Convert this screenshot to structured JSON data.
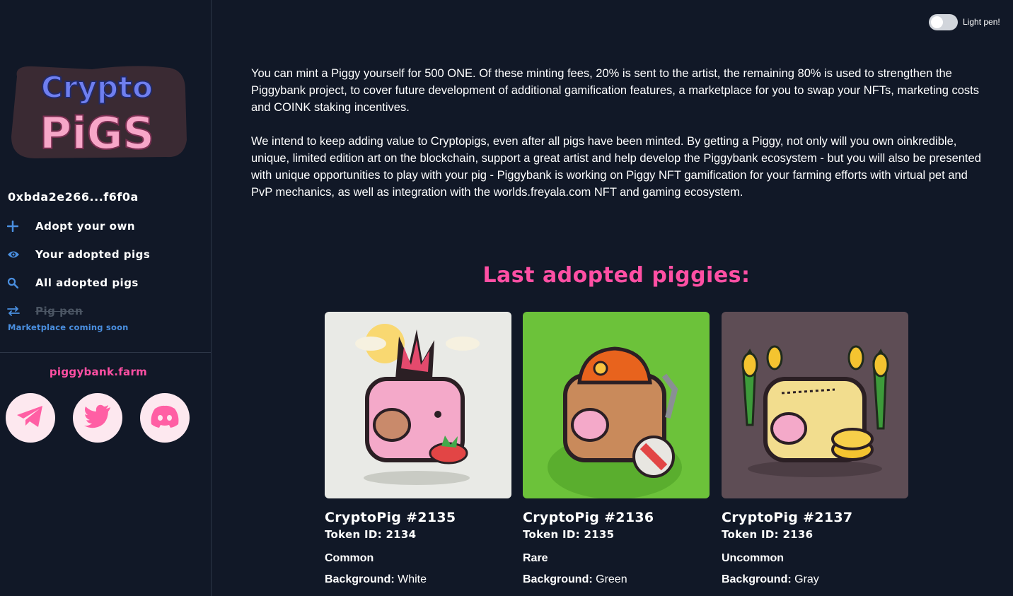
{
  "toggle": {
    "label": "Light pen!"
  },
  "logo": {
    "line1": "Crypto",
    "line2": "PiGS"
  },
  "sidebar": {
    "wallet": "0xbda2e266...f6f0a",
    "nav": [
      {
        "label": "Adopt your own",
        "icon": "plus-icon"
      },
      {
        "label": "Your adopted pigs",
        "icon": "eye-icon"
      },
      {
        "label": "All adopted pigs",
        "icon": "search-icon"
      },
      {
        "label": "Pig pen",
        "icon": "swap-arrows-icon",
        "disabled": true
      }
    ],
    "note": "Marketplace coming soon",
    "farm_link": "piggybank.farm",
    "socials": [
      "telegram-icon",
      "twitter-icon",
      "discord-icon"
    ]
  },
  "main": {
    "para1": "You can mint a Piggy yourself for 500 ONE. Of these minting fees, 20% is sent to the artist, the remaining 80% is used to strengthen the Piggybank project, to cover future development of additional gamification features, a marketplace for you to swap your NFTs, marketing costs and COINK staking incentives.",
    "para2": "We intend to keep adding value to Cryptopigs, even after all pigs have been minted. By getting a Piggy, not only will you own oinkredible, unique, limited edition art on the blockchain, support a great artist and help develop the Piggybank ecosystem - but you will also be presented with unique opportunities to play with your pig - Piggybank is working on Piggy NFT gamification for your farming efforts with virtual pet and PvP mechanics, as well as integration with the worlds.freyala.com NFT and gaming ecosystem.",
    "section_title": "Last adopted piggies:",
    "background_label": "Background:",
    "cards": [
      {
        "name": "CryptoPig #2135",
        "token": "Token ID: 2134",
        "rarity": "Common",
        "background": "White",
        "bg_color": "#e9eae6"
      },
      {
        "name": "CryptoPig #2136",
        "token": "Token ID: 2135",
        "rarity": "Rare",
        "background": "Green",
        "bg_color": "#6cc23a"
      },
      {
        "name": "CryptoPig #2137",
        "token": "Token ID: 2136",
        "rarity": "Uncommon",
        "background": "Gray",
        "bg_color": "#5e4d55"
      }
    ]
  },
  "colors": {
    "background": "#111827",
    "accent_pink": "#ff4fa3",
    "link_blue": "#4a8fe0"
  }
}
